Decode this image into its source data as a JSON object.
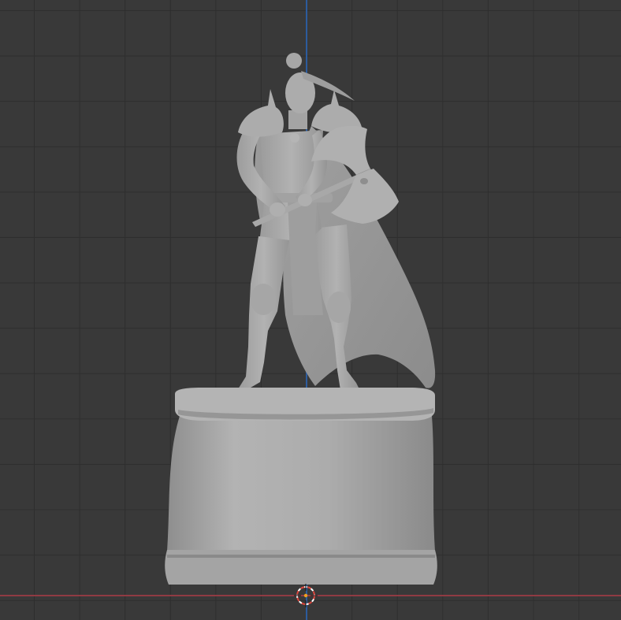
{
  "viewport": {
    "view": "front-orthographic",
    "shading": "solid",
    "colors": {
      "background": "#393939",
      "grid_line": "#2e2e2e",
      "z_axis": "#2b64b0",
      "x_axis": "#9a3c45",
      "model": "#a8a8a8",
      "cursor_red": "#e0453c",
      "cursor_white": "#ffffff",
      "origin_dot": "#f0a020"
    }
  },
  "scene": {
    "object_type": "statue-miniature",
    "subject": "warrior-with-double-axe-on-pedestal"
  },
  "icons": {
    "cursor": "3d-cursor-icon"
  }
}
